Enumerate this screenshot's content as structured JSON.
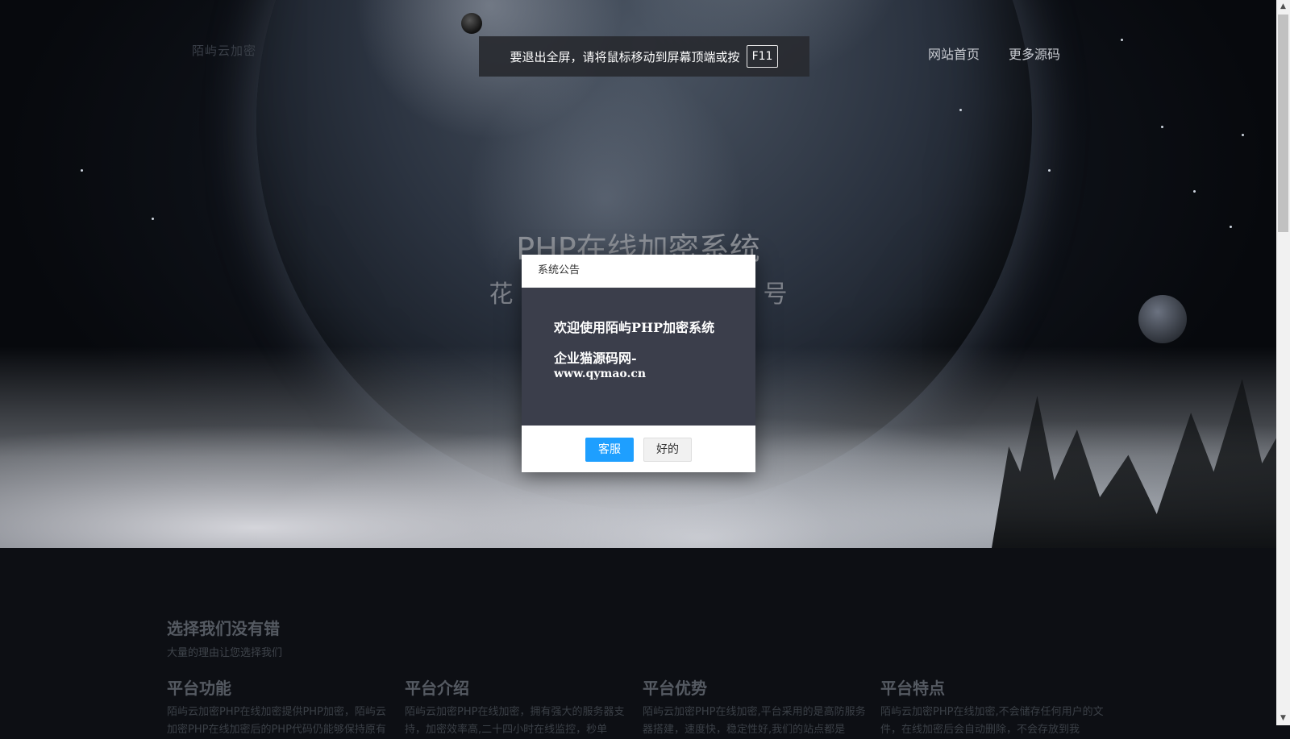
{
  "header": {
    "logo_text": "陌屿云加密",
    "nav": [
      "网站首页",
      "更多源码"
    ]
  },
  "fullscreen_tip": {
    "text": "要退出全屏，请将鼠标移动到屏幕顶端或按",
    "key": "F11"
  },
  "hero": {
    "title": "PHP在线加密系统",
    "subtitle_left": "花",
    "subtitle_right": "号"
  },
  "modal": {
    "title": "系统公告",
    "line1": "欢迎使用陌屿PHP加密系统",
    "line2": "企业猫源码网-",
    "line3": "www.qymao.cn",
    "primary_button": "客服",
    "secondary_button": "好的"
  },
  "section": {
    "title": "选择我们没有错",
    "subtitle": "大量的理由让您选择我们",
    "features": [
      {
        "title": "平台功能",
        "desc": "陌屿云加密PHP在线加密提供PHP加密，陌屿云加密PHP在线加密后的PHP代码仍能够保持原有"
      },
      {
        "title": "平台介绍",
        "desc": "陌屿云加密PHP在线加密，拥有强大的服务器支持，加密效率高,二十四小时在线监控，秒单"
      },
      {
        "title": "平台优势",
        "desc": "陌屿云加密PHP在线加密,平台采用的是高防服务器搭建，速度快，稳定性好,我们的站点都是"
      },
      {
        "title": "平台特点",
        "desc": "陌屿云加密PHP在线加密,不会储存任何用户的文件，在线加密后会自动删除，不会存放到我"
      }
    ]
  },
  "colors": {
    "primary_button": "#1e9fff",
    "modal_body": "#3b3e4b"
  }
}
